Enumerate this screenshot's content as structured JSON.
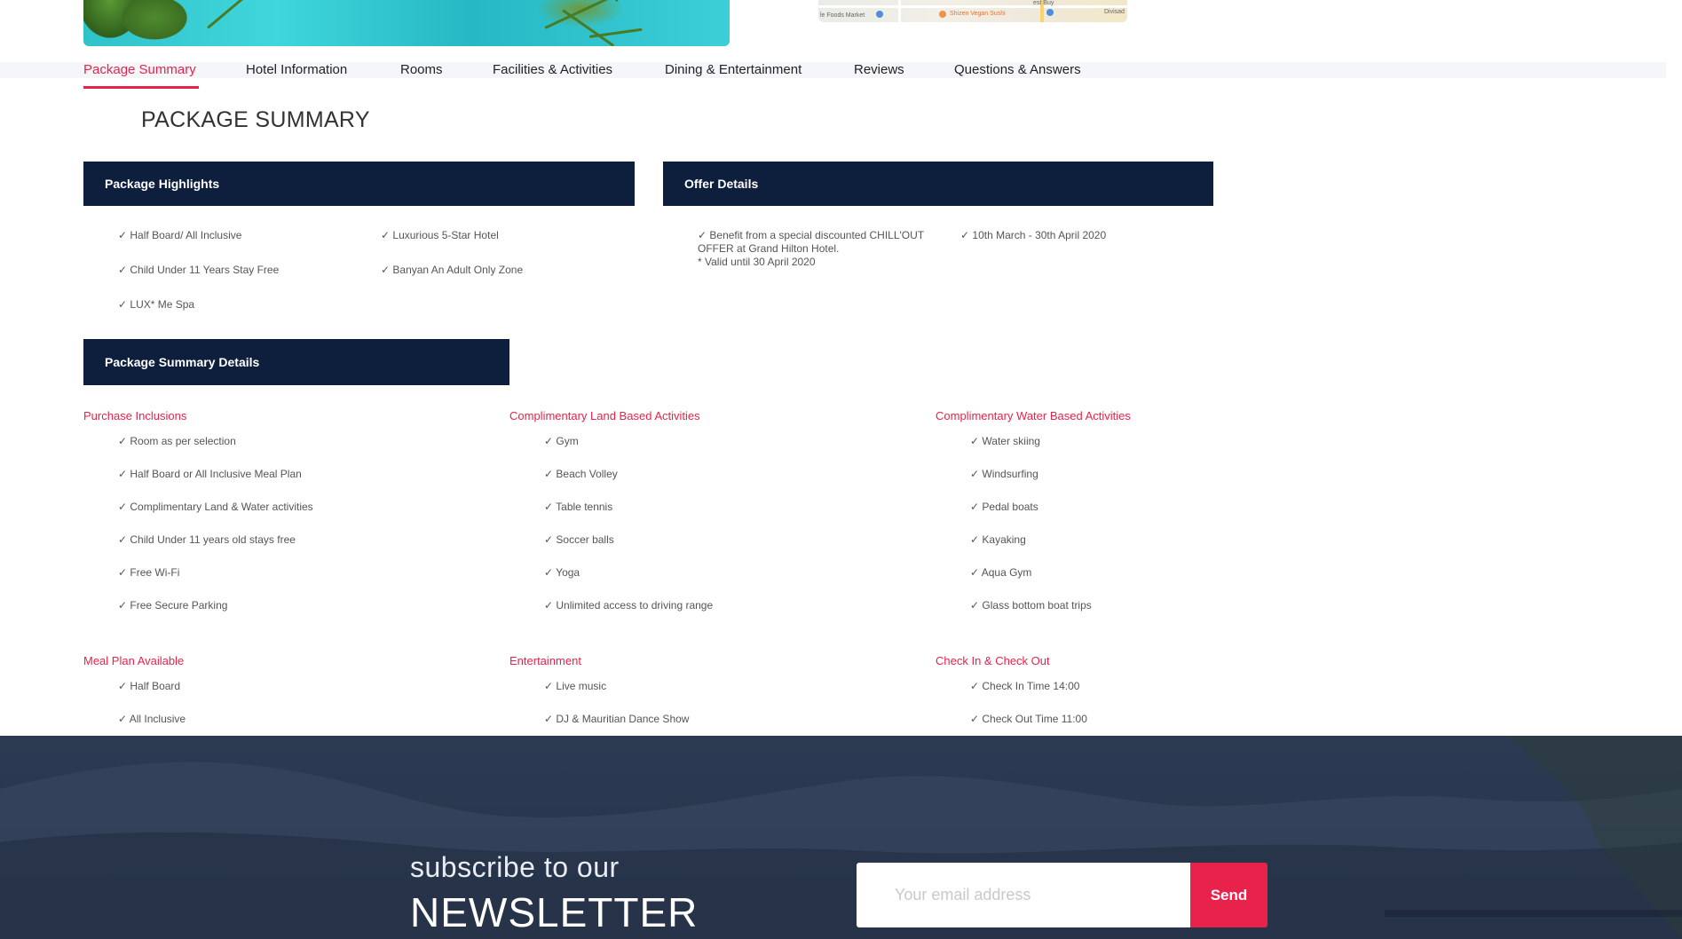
{
  "tabs": [
    {
      "label": "Package Summary",
      "active": true
    },
    {
      "label": "Hotel Information"
    },
    {
      "label": "Rooms"
    },
    {
      "label": "Facilities & Activities"
    },
    {
      "label": "Dining & Entertainment"
    },
    {
      "label": "Reviews"
    },
    {
      "label": "Questions & Answers"
    }
  ],
  "map": {
    "labels": [
      "le Foods Market",
      "Shizen Vegan Sushi",
      "est Buy",
      "Divisad"
    ]
  },
  "section_title": "PACKAGE SUMMARY",
  "highlights": {
    "heading": "Package Highlights",
    "items": [
      "✓ Half Board/ All Inclusive",
      "✓ Luxurious 5-Star Hotel",
      "✓ Child Under 11 Years Stay Free",
      "✓ Banyan An Adult Only Zone",
      "✓ LUX* Me Spa"
    ]
  },
  "offer": {
    "heading": "Offer Details",
    "description": "✓ Benefit from a special discounted CHILL'OUT OFFER at Grand Hilton Hotel.",
    "validity": "* Valid until 30 April 2020",
    "dates": "✓ 10th March - 30th April 2020"
  },
  "details": {
    "heading": "Package Summary Details",
    "categories": [
      {
        "title": "Purchase Inclusions",
        "items": [
          "✓ Room as per selection",
          "✓ Half Board or All Inclusive Meal Plan",
          "✓ Complimentary Land & Water activities",
          "✓ Child Under 11 years old stays free",
          "✓ Free Wi-Fi",
          "✓ Free Secure Parking"
        ]
      },
      {
        "title": "Complimentary Land Based Activities",
        "items": [
          "✓ Gym",
          "✓ Beach Volley",
          "✓ Table tennis",
          "✓ Soccer balls",
          "✓ Yoga",
          "✓ Unlimited access to driving range"
        ]
      },
      {
        "title": "Complimentary Water Based Activities",
        "items": [
          "✓ Water skiing",
          "✓ Windsurfing",
          "✓ Pedal boats",
          "✓ Kayaking",
          "✓ Aqua Gym",
          "✓ Glass bottom boat trips"
        ]
      },
      {
        "title": "Meal Plan Available",
        "items": [
          "✓ Half Board",
          "✓ All Inclusive"
        ]
      },
      {
        "title": "Entertainment",
        "items": [
          "✓ Live music",
          "✓ DJ & Mauritian Dance Show"
        ]
      },
      {
        "title": "Check In & Check Out",
        "items": [
          "✓ Check In Time 14:00",
          "✓ Check Out Time 11:00"
        ]
      }
    ]
  },
  "newsletter": {
    "subtitle": "subscribe to our",
    "title": "NEWSLETTER",
    "email_placeholder": "Your email address",
    "send_label": "Send"
  },
  "colors": {
    "accent": "#e8224b",
    "panel": "#0d1f3c"
  }
}
